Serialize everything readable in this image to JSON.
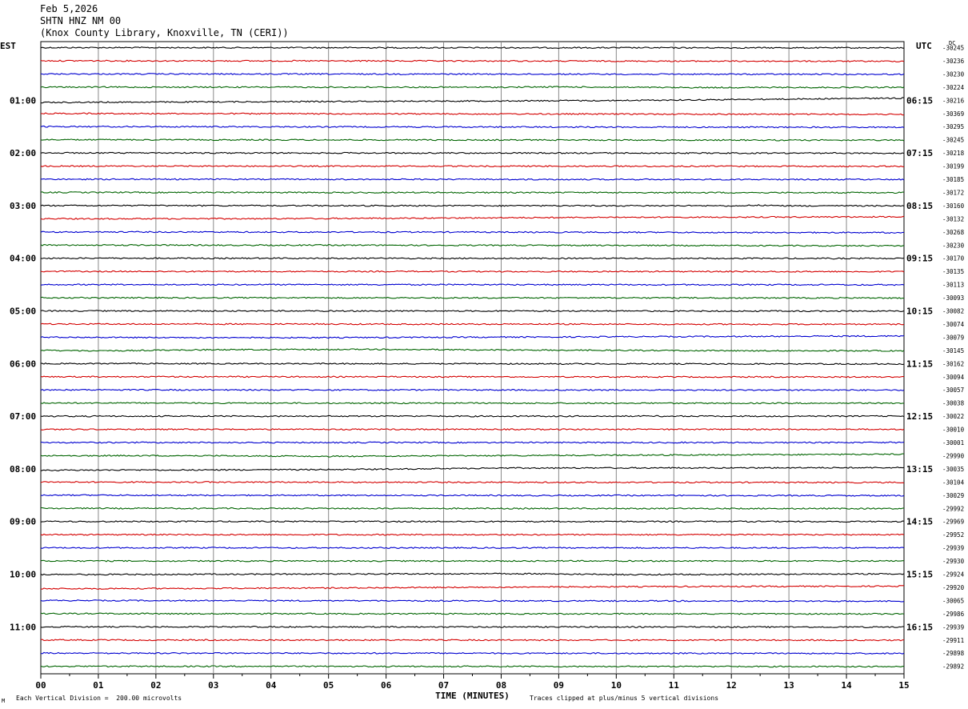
{
  "header": {
    "date": "Feb 5,2026",
    "station": "SHTN HNZ NM 00",
    "location": "(Knox County Library, Knoxville, TN (CERI))"
  },
  "footer": {
    "scale_note": "Each Vertical Division =  200.00 microvolts",
    "clip_note": "Traces clipped at plus/minus 5 vertical divisions",
    "corner_mark": "M"
  },
  "colors": {
    "cycle": [
      "#000000",
      "#d40000",
      "#0000d0",
      "#006400"
    ],
    "grid": "#888888"
  },
  "chart_data": {
    "type": "line",
    "title": "",
    "xlabel": "TIME (MINUTES)",
    "ylabel_left": "EST",
    "ylabel_right": "UTC",
    "dc_label": "DC",
    "xlim": [
      0,
      15
    ],
    "x_ticks": [
      "00",
      "01",
      "02",
      "03",
      "04",
      "05",
      "06",
      "07",
      "08",
      "09",
      "10",
      "11",
      "12",
      "13",
      "14",
      "15"
    ],
    "left_hour_labels": [
      "01:00",
      "02:00",
      "03:00",
      "04:00",
      "05:00",
      "06:00",
      "07:00",
      "08:00",
      "09:00",
      "10:00",
      "11:00"
    ],
    "right_hour_labels": [
      "06:15",
      "07:15",
      "08:15",
      "09:15",
      "10:15",
      "11:15",
      "12:15",
      "13:15",
      "14:15",
      "15:15",
      "16:15"
    ],
    "hour_label_rows": [
      4,
      8,
      12,
      16,
      20,
      24,
      28,
      32,
      36,
      40,
      44
    ],
    "dc_offsets": [
      -30245,
      -30236,
      -30230,
      -30224,
      -30216,
      -30369,
      -30295,
      -30245,
      -30218,
      -30199,
      -30185,
      -30172,
      -30160,
      -30132,
      -30268,
      -30230,
      -30170,
      -30135,
      -30113,
      -30093,
      -30082,
      -30074,
      -30079,
      -30145,
      -30162,
      -30094,
      -30057,
      -30038,
      -30022,
      -30010,
      -30001,
      -29990,
      -30035,
      -30104,
      -30029,
      -29992,
      -29969,
      -29952,
      -29939,
      -29930,
      -29924,
      -29920,
      -30065,
      -29986,
      -29939,
      -29911,
      -29898,
      -29892
    ],
    "drift_divisions": [
      [
        [
          0,
          0
        ],
        [
          15,
          0.1
        ]
      ],
      [
        [
          0,
          0
        ],
        [
          15,
          0.2
        ]
      ],
      [
        [
          0,
          0
        ],
        [
          15,
          0.15
        ]
      ],
      [
        [
          0,
          0
        ],
        [
          8,
          0.05
        ],
        [
          9,
          -0.1
        ],
        [
          11,
          0.2
        ],
        [
          15,
          0.1
        ]
      ],
      [
        [
          0,
          0.9
        ],
        [
          5,
          0.5
        ],
        [
          10,
          0.1
        ],
        [
          15,
          -0.9
        ]
      ],
      [
        [
          0,
          0
        ],
        [
          15,
          0.4
        ]
      ],
      [
        [
          0,
          0
        ],
        [
          15,
          0.3
        ]
      ],
      [
        [
          0,
          0
        ],
        [
          15,
          0.2
        ]
      ],
      [
        [
          0,
          0
        ],
        [
          15,
          0.1
        ]
      ],
      [
        [
          0,
          0
        ],
        [
          15,
          0.1
        ]
      ],
      [
        [
          0,
          0
        ],
        [
          15,
          0.1
        ]
      ],
      [
        [
          0,
          0
        ],
        [
          15,
          0.1
        ]
      ],
      [
        [
          0,
          0
        ],
        [
          12,
          0.1
        ],
        [
          12.5,
          -0.15
        ],
        [
          13,
          0.1
        ],
        [
          15,
          0.1
        ]
      ],
      [
        [
          0,
          0
        ],
        [
          4,
          0
        ],
        [
          10,
          -0.6
        ],
        [
          15,
          -0.8
        ]
      ],
      [
        [
          0,
          0
        ],
        [
          7,
          0.1
        ],
        [
          15,
          0.3
        ]
      ],
      [
        [
          0,
          0
        ],
        [
          8,
          0.1
        ],
        [
          15,
          0.3
        ]
      ],
      [
        [
          0,
          0
        ],
        [
          15,
          0.1
        ]
      ],
      [
        [
          0,
          0
        ],
        [
          15,
          0.1
        ]
      ],
      [
        [
          0,
          0
        ],
        [
          15,
          0.1
        ]
      ],
      [
        [
          0,
          0
        ],
        [
          15,
          0.1
        ]
      ],
      [
        [
          0,
          0
        ],
        [
          15,
          0.1
        ]
      ],
      [
        [
          0,
          0
        ],
        [
          15,
          0.1
        ]
      ],
      [
        [
          0,
          0
        ],
        [
          1,
          0.1
        ],
        [
          5,
          0.2
        ],
        [
          10,
          -0.2
        ],
        [
          15,
          -0.5
        ]
      ],
      [
        [
          0,
          0
        ],
        [
          1,
          0.2
        ],
        [
          3,
          -0.3
        ],
        [
          6,
          -0.4
        ],
        [
          11,
          0.1
        ],
        [
          15,
          0.2
        ]
      ],
      [
        [
          0,
          0
        ],
        [
          15,
          0.2
        ]
      ],
      [
        [
          0,
          0
        ],
        [
          15,
          0.1
        ]
      ],
      [
        [
          0,
          0
        ],
        [
          15,
          0.1
        ]
      ],
      [
        [
          0,
          0
        ],
        [
          15,
          0.1
        ]
      ],
      [
        [
          0,
          0
        ],
        [
          15,
          0
        ]
      ],
      [
        [
          0,
          0
        ],
        [
          15,
          0
        ]
      ],
      [
        [
          0,
          0
        ],
        [
          15,
          0
        ]
      ],
      [
        [
          0,
          0
        ],
        [
          3,
          0
        ],
        [
          5,
          0.3
        ],
        [
          10,
          -0.2
        ],
        [
          15,
          -0.6
        ]
      ],
      [
        [
          0,
          0.6
        ],
        [
          5,
          0.3
        ],
        [
          8,
          -0.3
        ],
        [
          15,
          -0.5
        ]
      ],
      [
        [
          0,
          0
        ],
        [
          15,
          0.2
        ]
      ],
      [
        [
          0,
          0
        ],
        [
          15,
          0.2
        ]
      ],
      [
        [
          0,
          0
        ],
        [
          15,
          0.1
        ]
      ],
      [
        [
          0,
          0
        ],
        [
          15,
          0
        ]
      ],
      [
        [
          0,
          0
        ],
        [
          15,
          0
        ]
      ],
      [
        [
          0,
          0
        ],
        [
          15,
          0
        ]
      ],
      [
        [
          0,
          0
        ],
        [
          15,
          0
        ]
      ],
      [
        [
          0,
          0.2
        ],
        [
          8.3,
          -0.2
        ],
        [
          10,
          0.2
        ],
        [
          15,
          -0.1
        ]
      ],
      [
        [
          0,
          0.6
        ],
        [
          5,
          0.3
        ],
        [
          9,
          -0.2
        ],
        [
          15,
          -0.5
        ]
      ],
      [
        [
          0,
          0
        ],
        [
          15,
          0.3
        ]
      ],
      [
        [
          0,
          0
        ],
        [
          15,
          0.1
        ]
      ],
      [
        [
          0,
          0
        ],
        [
          15,
          0.1
        ]
      ],
      [
        [
          0,
          0
        ],
        [
          15,
          0.1
        ]
      ],
      [
        [
          0,
          0
        ],
        [
          15,
          0.1
        ]
      ],
      [
        [
          0,
          0
        ],
        [
          15,
          0.1
        ]
      ]
    ]
  }
}
